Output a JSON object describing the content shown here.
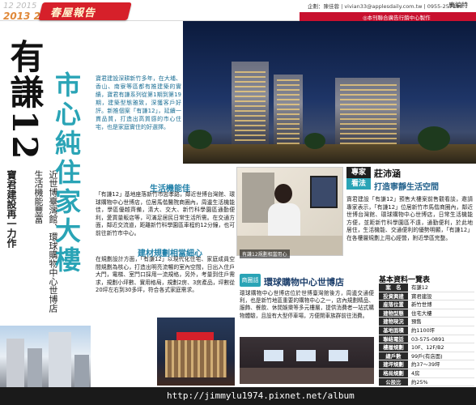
{
  "header": {
    "issue_date": "12 2015",
    "issue_year": "2013 2015",
    "section_badge": "春屋報告",
    "contact_line": "企劃：陳佳蓉 | vivian33@applesdaily.com.tw | 0955-257180",
    "adv_label": "廣編特",
    "sub_note": "◎本刊聯合廣告行銷中心製作",
    "extra_label": "稿"
  },
  "headline": {
    "main": "有謙12",
    "tagline_1": "寶君建設再一力作",
    "tagline_2": "生活機能豐富",
    "tagline_3": "近世博臺灣館、環球購物中心世博店"
  },
  "center_title": "市心純住家大樓",
  "intro_text": "寶君建設深耕新竹多年，在大埔、香山、南寮等區都有推建築的實績，寶君有謙系列從第1期到第19期，建築型態雅致，深獲客戶好評。新推個案「有謙12」，延續一貫品質，打造出高質感的市心住宅，也是家庭實住的好選擇。",
  "sections": {
    "living": {
      "title": "生活機能佳",
      "body": "「有謙12」基地座落新竹市忠孝路，鄰近世博台灣館、環球購物中心世博店，位居馬偕醫院商圈內，周邊生活機能佳，學區優越齊備，清大、交大、新竹科學園區通勤便利，愛買量販店等，可滿足居民日常生活所需。在交通方面，鄰近交流道，距離新竹科學園區車程約12分鐘，也可前往新竹市中心。"
    },
    "planning": {
      "title": "建材規劃相當細心",
      "body": "在規劃設計方面，「有謙12」以現代化住宅、家庭成員空間規劃為核心，打造出明亮流暢的室內空間，日出入住戶大門，電梯、室門口採用一流規格，另外，考量到住戶需求，規劃小坪數、實用格局，規劃2房、3房產品，坪數從20坪左右到30多坪，符合各式家庭需求。"
    }
  },
  "photo_captions": {
    "person": "有謙12規劃相當用心"
  },
  "expert": {
    "tag1": "專家",
    "tag2": "看法",
    "name": "莊沛涵",
    "subtitle": "打造寧靜生活空間",
    "body": "寶君建設「有謙12」預售大樓案前售觀看談，邀請專家表示，「有謙12」位居新竹市馬偕商圈內，鄰近世博台灣館、環球購物中心世博店，日常生活機能方便，並距新竹科學園區不遠，通勤便利，於此地居住，生活機能、交通便利的優勢明顯，「有謙12」在各樓層規劃上用心經營，附近學區完整。"
  },
  "commercial": {
    "badge": "商圈話",
    "title": "環球購物中心世博店",
    "body": "環球購物中心世博店位於世博臺灣館後方，周邊交通便利，也是新竹地區重要的購物中心之一，店內規劃精品、服飾、餐飲、休閒娛樂等多元樓層，提供消費者一站式購物體驗，且設有大型停車場，方便開車族群前往消費。"
  },
  "info": {
    "title": "基本資料一覽表",
    "rows": [
      {
        "k": "案　名",
        "v": "有謙12"
      },
      {
        "k": "投資興建",
        "v": "寶君建設"
      },
      {
        "k": "座落位置",
        "v": "新竹世博"
      },
      {
        "k": "建物型態",
        "v": "住宅大樓"
      },
      {
        "k": "建物現況",
        "v": "預售"
      },
      {
        "k": "基地面積",
        "v": "約1100坪"
      },
      {
        "k": "聯絡電話",
        "v": "03-575-0891"
      },
      {
        "k": "樓層規劃",
        "v": "10F、12F/B2"
      },
      {
        "k": "總戶數",
        "v": "99戶(有店面)"
      },
      {
        "k": "建坪規劃",
        "v": "約37～39坪"
      },
      {
        "k": "格局規劃",
        "v": "4房"
      },
      {
        "k": "公設比",
        "v": "約25%"
      }
    ]
  },
  "watermark": "http://jimmylu1974.pixnet.net/album",
  "colors": {
    "accent_red": "#d6202a",
    "accent_teal": "#2aa4b6",
    "dark": "#1a1a1a"
  }
}
